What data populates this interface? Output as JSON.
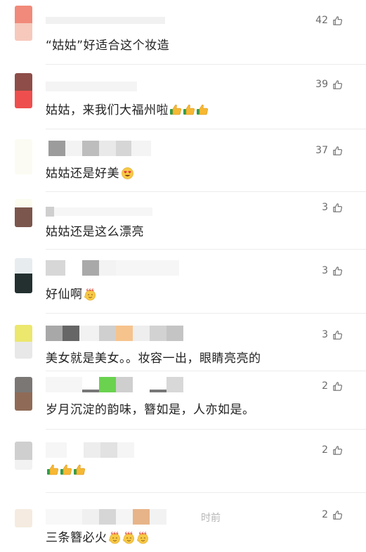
{
  "comments": [
    {
      "text": "“姑姑”好适合这个妆造",
      "likes": "42",
      "emoji": "none"
    },
    {
      "text": "姑姑，来我们大福州啦",
      "likes": "39",
      "emoji": "thumbs3"
    },
    {
      "text": "姑姑还是好美",
      "likes": "37",
      "emoji": "heart-eyes"
    },
    {
      "text": "姑姑还是这么漂亮",
      "likes": "3",
      "emoji": "none"
    },
    {
      "text": "好仙啊",
      "likes": "3",
      "emoji": "666"
    },
    {
      "text": "美女就是美女。。妆容一出，眼睛亮亮的",
      "likes": "3",
      "emoji": "none"
    },
    {
      "text": "岁月沉淀的韵味，簪如是，人亦如是。",
      "likes": "2",
      "emoji": "none"
    },
    {
      "text": "",
      "likes": "2",
      "emoji": "thumbs3"
    },
    {
      "text": "三条簪必火",
      "likes": "2",
      "emoji": "666x3",
      "time_suffix": "时前"
    }
  ],
  "colors": {
    "text": "#222222",
    "likes": "#6b6b6b",
    "divider": "#ececec"
  },
  "icons": [
    "thumbs-up-icon",
    "thumbs-up-emoji",
    "heart-eyes-emoji",
    "666-emoji"
  ]
}
